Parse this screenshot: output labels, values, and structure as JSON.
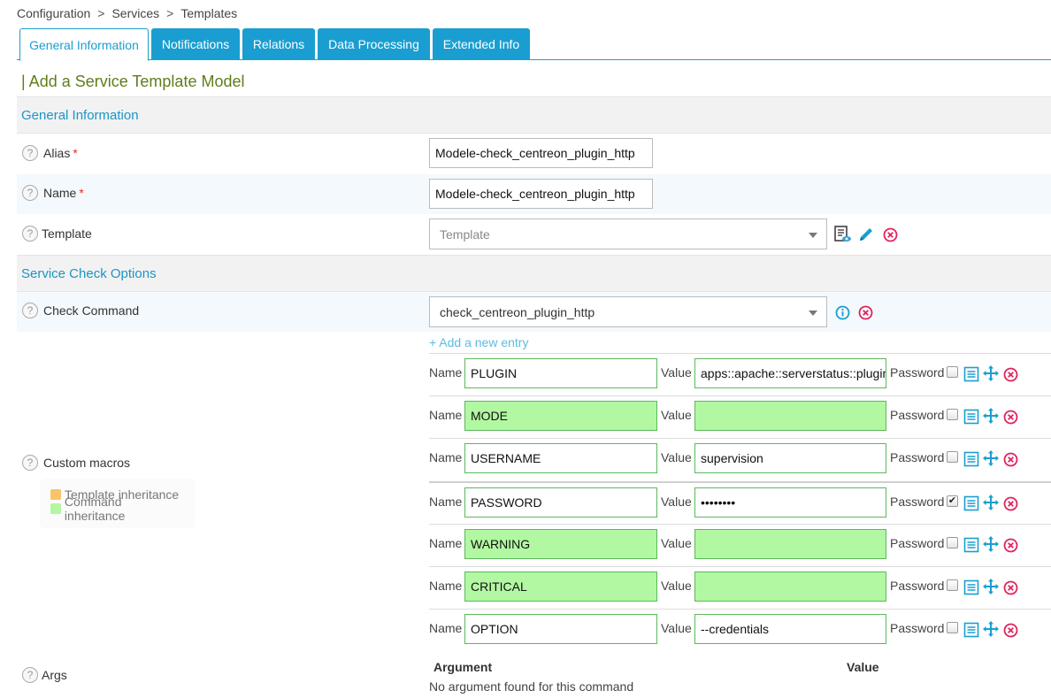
{
  "breadcrumb": [
    "Configuration",
    "Services",
    "Templates"
  ],
  "tabs": [
    "General Information",
    "Notifications",
    "Relations",
    "Data Processing",
    "Extended Info"
  ],
  "page_title": "| Add a Service Template Model",
  "sections": {
    "general": "General Information",
    "check": "Service Check Options"
  },
  "fields": {
    "alias": {
      "label": "Alias",
      "value": "Modele-check_centreon_plugin_http"
    },
    "name": {
      "label": "Name",
      "value": "Modele-check_centreon_plugin_http"
    },
    "template": {
      "label": "Template",
      "placeholder": "Template"
    },
    "check_command": {
      "label": "Check Command",
      "value": "check_centreon_plugin_http"
    }
  },
  "required_mark": "*",
  "custom_macros": {
    "label": "Custom macros",
    "add_entry": "+ Add a new entry",
    "name_label": "Name",
    "value_label": "Value",
    "password_label": "Password",
    "legend": {
      "template": "Template inheritance",
      "command": "Command inheritance",
      "template_color": "#f7c36b",
      "command_color": "#b2f7a2"
    },
    "items": [
      {
        "name": "PLUGIN",
        "value": "apps::apache::serverstatus::plugin",
        "password": false,
        "name_green": false,
        "value_green": false
      },
      {
        "name": "MODE",
        "value": "",
        "password": false,
        "name_green": true,
        "value_green": true
      },
      {
        "name": "USERNAME",
        "value": "supervision",
        "password": false,
        "name_green": false,
        "value_green": false
      },
      {
        "name": "PASSWORD",
        "value": "••••••••",
        "password": true,
        "name_green": false,
        "value_green": false
      },
      {
        "name": "WARNING",
        "value": "",
        "password": false,
        "name_green": true,
        "value_green": true
      },
      {
        "name": "CRITICAL",
        "value": "",
        "password": false,
        "name_green": true,
        "value_green": true
      },
      {
        "name": "OPTION",
        "value": "--credentials",
        "password": false,
        "name_green": false,
        "value_green": false
      }
    ]
  },
  "args": {
    "label": "Args",
    "col_argument": "Argument",
    "col_value": "Value",
    "empty": "No argument found for this command"
  },
  "colors": {
    "accent": "#1a9ed1",
    "title_green": "#5f7d1a",
    "delete_red": "#e0245e",
    "macro_green": "#b2f7a2"
  }
}
